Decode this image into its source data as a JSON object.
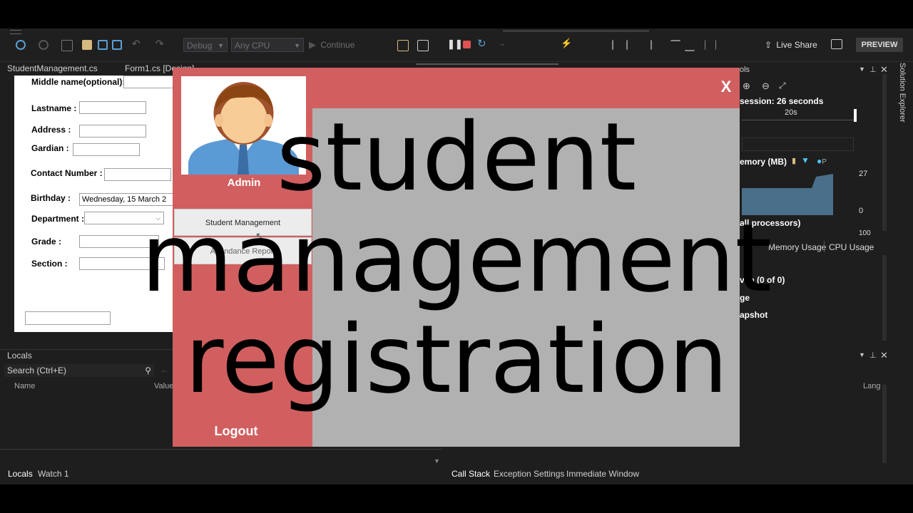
{
  "ide": {
    "toolbar": {
      "config_combo": "Debug",
      "platform_combo": "Any CPU",
      "continue_label": "Continue",
      "live_share_label": "Live Share",
      "preview_label": "PREVIEW"
    },
    "tabs": [
      "StudentManagement.cs",
      "Form1.cs [Design]"
    ],
    "designer_form": {
      "fields": [
        {
          "label": "Middle name(optional):",
          "value": ""
        },
        {
          "label": "Lastname :",
          "value": ""
        },
        {
          "label": "Address :",
          "value": ""
        },
        {
          "label": "Gardian :",
          "value": ""
        },
        {
          "label": "Contact Number :",
          "value": ""
        },
        {
          "label": "Birthday :",
          "value": "Wednesday, 15    March    2"
        },
        {
          "label": "Department :",
          "value": ""
        },
        {
          "label": "Grade :",
          "value": ""
        },
        {
          "label": "Section :",
          "value": ""
        }
      ]
    },
    "locals_panel": {
      "title": "Locals",
      "search_placeholder": "Search (Ctrl+E)",
      "col_name": "Name",
      "col_value": "Value",
      "col_lang": "Lang"
    },
    "diagnostics": {
      "title_fragment": "ols",
      "session_text": "session: 26 seconds",
      "timeline_label": "20s",
      "memory_label": "emory (MB)",
      "memory_max": "27",
      "memory_min": "0",
      "cpu_label": "all processors)",
      "cpu_max": "100",
      "tabs": [
        "Memory Usage",
        "CPU Usage"
      ],
      "events_text": "ven  (0 of 0)",
      "usage_text": "ge",
      "snapshot_text": "apshot"
    },
    "side_tab": "Solution Explorer",
    "bottom_tabs_left": [
      "Locals",
      "Watch 1"
    ],
    "bottom_tabs_right": [
      "Call Stack",
      "Exception Settings",
      "Immediate Window"
    ]
  },
  "app": {
    "close_label": "X",
    "user_label": "Admin",
    "nav_items": [
      "Student Management",
      "Attendance Report"
    ],
    "logout_label": "Logout"
  },
  "overlay_text": [
    "student",
    "management",
    "registration"
  ],
  "colors": {
    "app_red": "#d15f60",
    "content_gray": "#b1b1b1",
    "ide_bg": "#1e1e1e"
  }
}
